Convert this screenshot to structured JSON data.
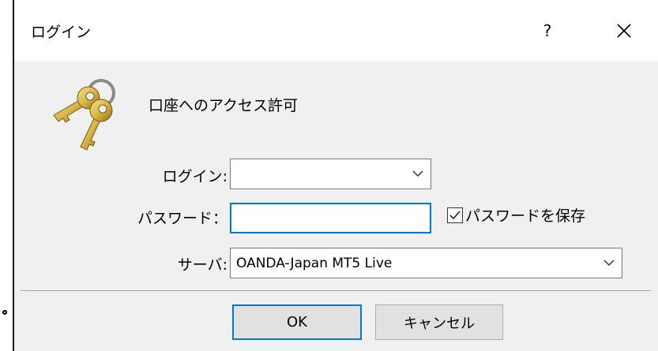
{
  "dialog": {
    "title": "ログイン",
    "help_label": "?",
    "heading": "口座へのアクセス許可"
  },
  "form": {
    "login_label": "ログイン:",
    "login_value": "",
    "password_label": "パスワード：",
    "password_value": "",
    "save_password_label": "パスワードを保存",
    "save_password_checked": true,
    "server_label": "サーバ:",
    "server_value": "OANDA-Japan MT5 Live"
  },
  "buttons": {
    "ok_label": "OK",
    "cancel_label": "キャンセル"
  },
  "colors": {
    "focus_border": "#0078d7",
    "key_gold": "#d9b64a"
  }
}
